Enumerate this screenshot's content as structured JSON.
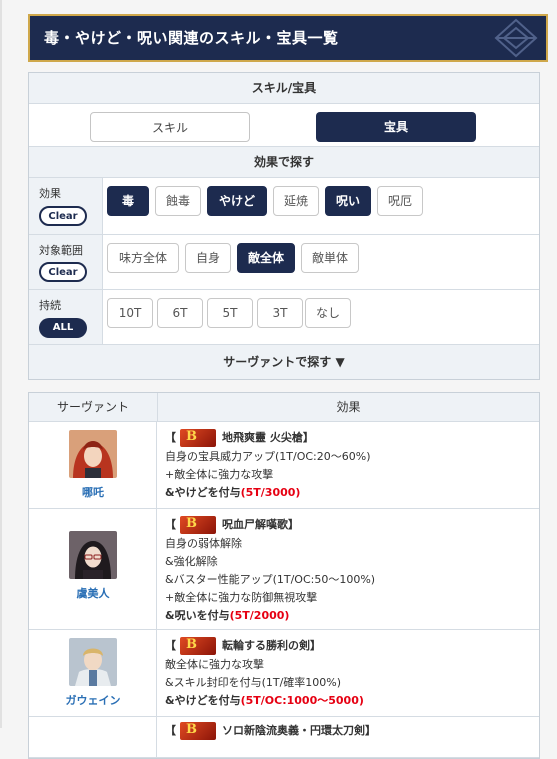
{
  "page": {
    "title": "毒・やけど・呪い関連のスキル・宝具一覧"
  },
  "filter": {
    "type_header": "スキル/宝具",
    "type_options": [
      "スキル",
      "宝具"
    ],
    "search_header": "効果で探す",
    "rows": [
      {
        "label": "効果",
        "pill": "Clear",
        "options": [
          {
            "label": "毒",
            "selected": true
          },
          {
            "label": "蝕毒",
            "selected": false
          },
          {
            "label": "やけど",
            "selected": true
          },
          {
            "label": "延焼",
            "selected": false
          },
          {
            "label": "呪い",
            "selected": true
          },
          {
            "label": "呪厄",
            "selected": false
          }
        ]
      },
      {
        "label": "対象範囲",
        "pill": "Clear",
        "options": [
          {
            "label": "味方全体",
            "selected": false
          },
          {
            "label": "自身",
            "selected": false
          },
          {
            "label": "敵全体",
            "selected": true
          },
          {
            "label": "敵単体",
            "selected": false
          }
        ]
      },
      {
        "label": "持続",
        "pill": "ALL",
        "options": [
          {
            "label": "10T",
            "selected": false
          },
          {
            "label": "6T",
            "selected": false
          },
          {
            "label": "5T",
            "selected": false
          },
          {
            "label": "3T",
            "selected": false
          },
          {
            "label": "なし",
            "selected": false
          }
        ]
      }
    ],
    "servant_toggle": "サーヴァントで探す ▼"
  },
  "table": {
    "headers": [
      "サーヴァント",
      "効果"
    ],
    "rows": [
      {
        "servant": "哪吒",
        "np_name": "地飛爽靈 火尖槍",
        "effects": [
          {
            "pre": "自身の宝具威力アップ(1T/OC:20〜60%)",
            "hl": "",
            "post": ""
          },
          {
            "pre": "+敵全体に強力な攻撃",
            "hl": "",
            "post": ""
          },
          {
            "pre": "&やけどを付与",
            "hl": "(5T/3000)",
            "post": ""
          }
        ]
      },
      {
        "servant": "虞美人",
        "np_name": "呪血尸解嘆歌",
        "effects": [
          {
            "pre": "自身の弱体解除",
            "hl": "",
            "post": ""
          },
          {
            "pre": "&強化解除",
            "hl": "",
            "post": ""
          },
          {
            "pre": "&バスター性能アップ(1T/OC:50〜100%)",
            "hl": "",
            "post": ""
          },
          {
            "pre": "+敵全体に強力な防御無視攻撃",
            "hl": "",
            "post": ""
          },
          {
            "pre": "&呪いを付与",
            "hl": "(5T/2000)",
            "post": ""
          }
        ]
      },
      {
        "servant": "ガウェイン",
        "np_name": "転輪する勝利の剣",
        "effects": [
          {
            "pre": "敵全体に強力な攻撃",
            "hl": "",
            "post": ""
          },
          {
            "pre": "&スキル封印を付与(1T/確率100%)",
            "hl": "",
            "post": ""
          },
          {
            "pre": "&やけどを付与",
            "hl": "(5T/OC:1000〜5000)",
            "post": ""
          }
        ]
      },
      {
        "servant": "",
        "np_name": "ソロ新陰流奥義・円環太刀剣",
        "effects": []
      }
    ]
  }
}
